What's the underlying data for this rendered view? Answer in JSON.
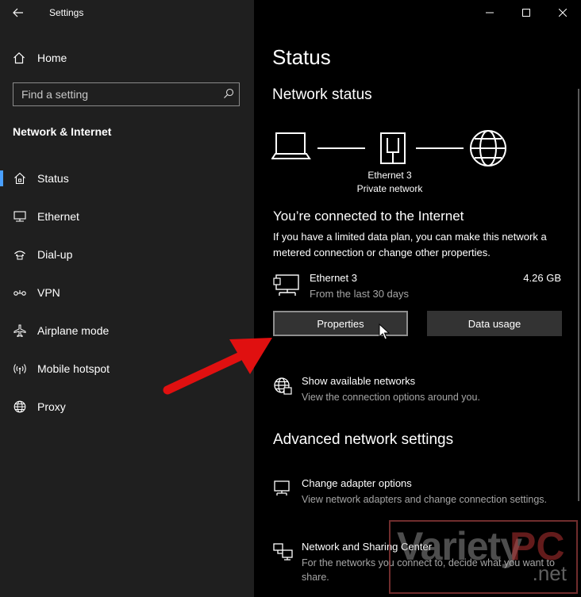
{
  "window": {
    "app_title": "Settings"
  },
  "sidebar": {
    "home_label": "Home",
    "search_placeholder": "Find a setting",
    "section_title": "Network & Internet",
    "items": [
      {
        "label": "Status",
        "icon": "home-network-icon",
        "active": true
      },
      {
        "label": "Ethernet",
        "icon": "ethernet-icon"
      },
      {
        "label": "Dial-up",
        "icon": "dialup-icon"
      },
      {
        "label": "VPN",
        "icon": "vpn-icon"
      },
      {
        "label": "Airplane mode",
        "icon": "airplane-icon"
      },
      {
        "label": "Mobile hotspot",
        "icon": "hotspot-icon"
      },
      {
        "label": "Proxy",
        "icon": "globe-icon"
      }
    ]
  },
  "main": {
    "title": "Status",
    "network_status_heading": "Network status",
    "diagram": {
      "adapter_name": "Ethernet 3",
      "network_type": "Private network"
    },
    "connection": {
      "title": "You’re connected to the Internet",
      "desc_line1": "If you have a limited data plan, you can make this network a",
      "desc_line2": "metered connection or change other properties."
    },
    "ethernet": {
      "name": "Ethernet 3",
      "period": "From the last 30 days",
      "usage": "4.26 GB"
    },
    "buttons": {
      "properties": "Properties",
      "data_usage": "Data usage"
    },
    "show_networks": {
      "title": "Show available networks",
      "desc": "View the connection options around you."
    },
    "advanced_heading": "Advanced network settings",
    "adapter_options": {
      "title": "Change adapter options",
      "desc": "View network adapters and change connection settings."
    },
    "sharing_center": {
      "title": "Network and Sharing Center",
      "desc": "For the networks you connect to, decide what you want to share."
    }
  },
  "watermark": {
    "part1": "Variety",
    "part2": "PC",
    "part3": ".net"
  },
  "colors": {
    "sidebar_bg": "#1f1f1f",
    "main_bg": "#000000",
    "accent": "#4aa0ff",
    "arrow": "#e01010"
  }
}
